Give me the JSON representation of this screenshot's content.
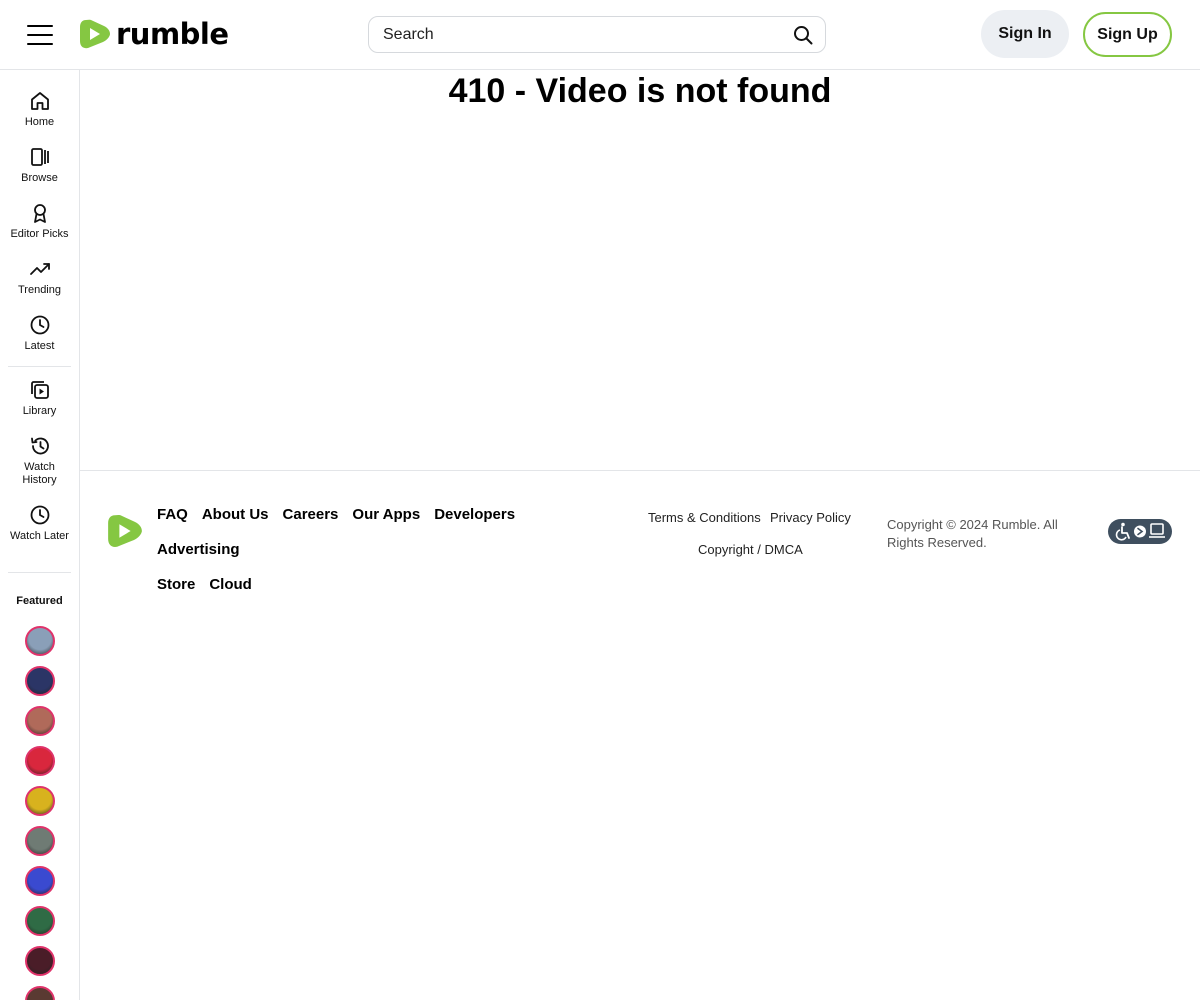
{
  "header": {
    "logo_text": "rumble",
    "search_placeholder": "Search",
    "signin_label": "Sign In",
    "signup_label": "Sign Up"
  },
  "sidebar": {
    "items": [
      {
        "label": "Home",
        "icon": "home-icon"
      },
      {
        "label": "Browse",
        "icon": "browse-icon"
      },
      {
        "label": "Editor Picks",
        "icon": "award-icon"
      },
      {
        "label": "Trending",
        "icon": "trending-icon"
      },
      {
        "label": "Latest",
        "icon": "clock-icon"
      },
      {
        "label": "Library",
        "icon": "library-icon"
      },
      {
        "label": "Watch History",
        "icon": "history-icon"
      },
      {
        "label": "Watch Later",
        "icon": "clock-icon"
      }
    ],
    "featured_title": "Featured",
    "featured_avatars": [
      {
        "color": "#8a9fb8"
      },
      {
        "color": "#2b3566"
      },
      {
        "color": "#b06a5a"
      },
      {
        "color": "#d9273d"
      },
      {
        "color": "#d8b21e"
      },
      {
        "color": "#6f7b74"
      },
      {
        "color": "#3a4ad0"
      },
      {
        "color": "#2f6b45"
      },
      {
        "color": "#4a1d28"
      },
      {
        "color": "#5a3a32"
      }
    ]
  },
  "main": {
    "title": "410 - Video is not found"
  },
  "footer": {
    "links": [
      "FAQ",
      "About Us",
      "Careers",
      "Our Apps",
      "Developers",
      "Advertising",
      "Store",
      "Cloud"
    ],
    "terms": "Terms & Conditions",
    "privacy": "Privacy Policy",
    "dmca": "Copyright / DMCA",
    "copyright": "Copyright © 2024 Rumble. All Rights Reserved."
  },
  "colors": {
    "brand_green": "#85c742",
    "avatar_ring": "#e0326a"
  }
}
